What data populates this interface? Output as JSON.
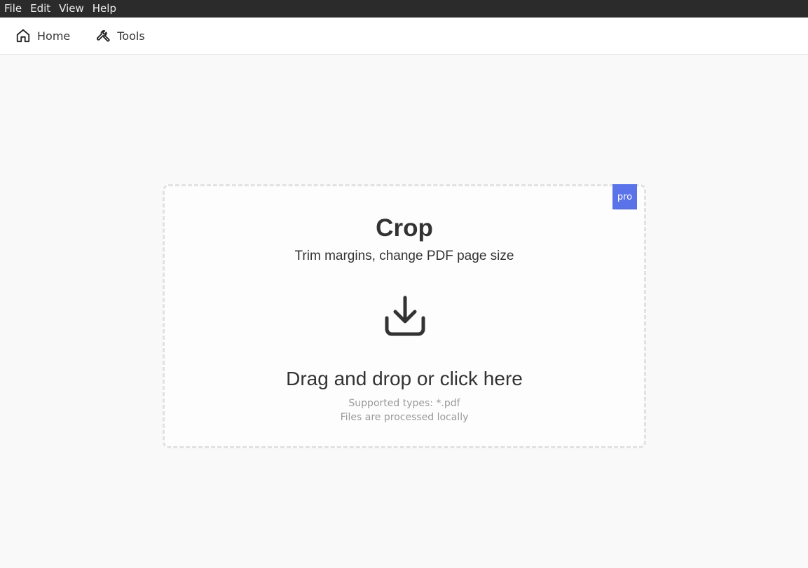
{
  "menubar": {
    "items": [
      "File",
      "Edit",
      "View",
      "Help"
    ]
  },
  "navbar": {
    "home_label": "Home",
    "tools_label": "Tools"
  },
  "dropzone": {
    "badge": "pro",
    "title": "Crop",
    "subtitle": "Trim margins, change PDF page size",
    "cta": "Drag and drop or click here",
    "supported_types": "Supported types: *.pdf",
    "local_note": "Files are processed locally",
    "icon": "download-tray-icon"
  },
  "colors": {
    "menubar_bg": "#2b2b2b",
    "accent": "#5b73e8",
    "text": "#333333",
    "muted": "#999999"
  }
}
